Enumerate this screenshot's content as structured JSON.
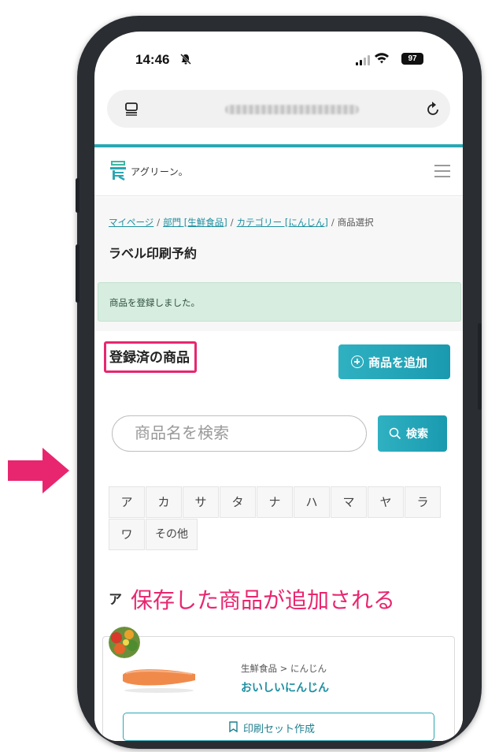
{
  "status_bar": {
    "time": "14:46",
    "battery": "97"
  },
  "site": {
    "logo_text": "アグリーン。"
  },
  "breadcrumb": {
    "items": [
      "マイページ",
      "部門 [生鮮食品]",
      "カテゴリー [にんじん]"
    ],
    "current": "商品選択",
    "separator": "/"
  },
  "page_title": "ラベル印刷予約",
  "alert": {
    "message": "商品を登録しました。"
  },
  "section": {
    "title": "登録済の商品",
    "add_button": "商品を追加"
  },
  "search": {
    "placeholder": "商品名を検索",
    "button": "検索"
  },
  "kana_filters": [
    "ア",
    "カ",
    "サ",
    "タ",
    "ナ",
    "ハ",
    "マ",
    "ヤ",
    "ラ",
    "ワ",
    "その他"
  ],
  "group_heading": "ア",
  "annotation": "保存した商品が追加される",
  "product": {
    "category_path": "生鮮食品 > にんじん",
    "name": "おいしいにんじん",
    "print_button": "印刷セット作成"
  },
  "colors": {
    "accent": "#2aa7b3",
    "highlight": "#e8266f",
    "alert_bg": "#d6ede0"
  },
  "icons": [
    "silent-bell-icon",
    "signal-icon",
    "wifi-icon",
    "battery-icon",
    "tabs-icon",
    "reload-icon",
    "logo-icon",
    "menu-icon",
    "plus-circle-icon",
    "search-icon",
    "bookmark-icon",
    "callout-arrow-icon"
  ]
}
